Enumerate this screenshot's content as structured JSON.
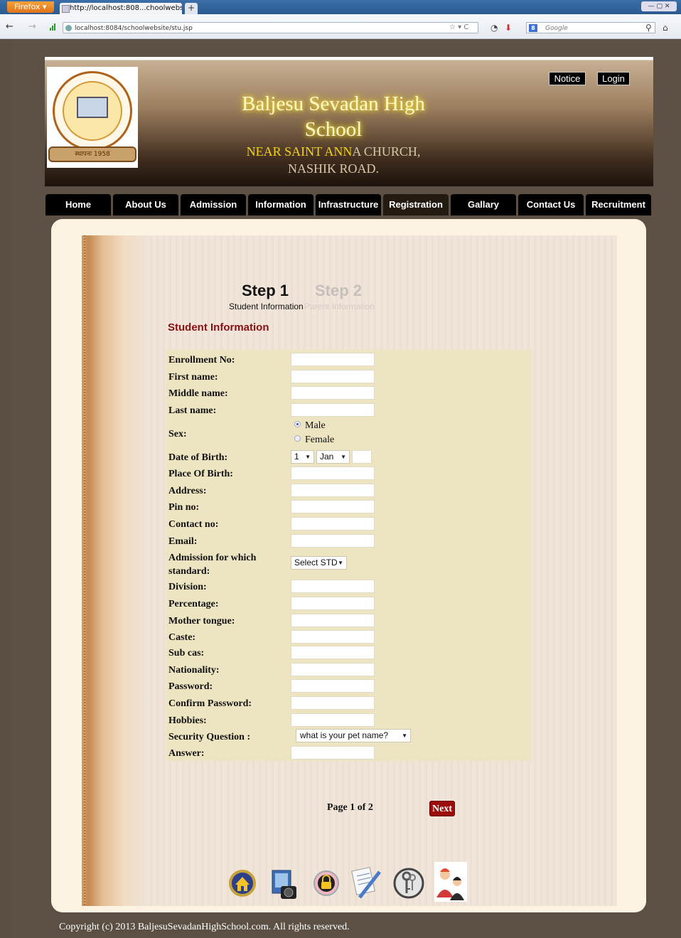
{
  "browser": {
    "app_button": "Firefox",
    "tab_title": "http://localhost:808...choolwebsite/stu.jsp",
    "new_tab": "+",
    "url": "localhost:8084/schoolwebsite/stu.jsp",
    "search_placeholder": "Google"
  },
  "header": {
    "title": "Baljesu Sevadan High School",
    "subtitle_highlight": "NEAR SAINT ANN",
    "subtitle_rest": "A CHURCH, NASHIK ROAD.",
    "logo_ribbon": "स्थापना 1958",
    "notice_label": "Notice",
    "login_label": "Login"
  },
  "menu": [
    {
      "label": "Home"
    },
    {
      "label": "About Us"
    },
    {
      "label": "Admission"
    },
    {
      "label": "Information"
    },
    {
      "label": "Infrastructure"
    },
    {
      "label": "Registration",
      "active": true
    },
    {
      "label": "Gallary"
    },
    {
      "label": "Contact Us"
    },
    {
      "label": "Recruitment"
    }
  ],
  "steps": {
    "step1": "Step 1",
    "step1_sub": "Student Information",
    "step2": "Step 2",
    "step2_sub": "Parent Information"
  },
  "section_title": "Student Information",
  "form": {
    "enrollment": "Enrollment No:",
    "first_name": "First name:",
    "middle_name": "Middle name:",
    "last_name": "Last name:",
    "sex": "Sex:",
    "male": "Male",
    "female": "Female",
    "dob": "Date of Birth:",
    "dob_day": "1",
    "dob_month": "Jan",
    "place_of_birth": "Place Of Birth:",
    "address": "Address:",
    "pin": "Pin no:",
    "contact": "Contact no:",
    "email": "Email:",
    "standard_line1": "Admission for which",
    "standard_line2": "standard:",
    "standard_select": "Select STD",
    "division": "Division:",
    "percentage": "Percentage:",
    "mother_tongue": "Mother tongue:",
    "caste": "Caste:",
    "sub_caste": "Sub cas:",
    "nationality": "Nationality:",
    "password": "Password:",
    "confirm_password": "Confirm Password:",
    "hobbies": "Hobbies:",
    "security_question": "Security Question :",
    "security_select": "what is your pet name?",
    "answer": "Answer:"
  },
  "pager": {
    "page_info": "Page 1 of 2",
    "next": "Next"
  },
  "footer": "Copyright (c) 2013 BaljesuSevadanHighSchool.com. All rights reserved."
}
